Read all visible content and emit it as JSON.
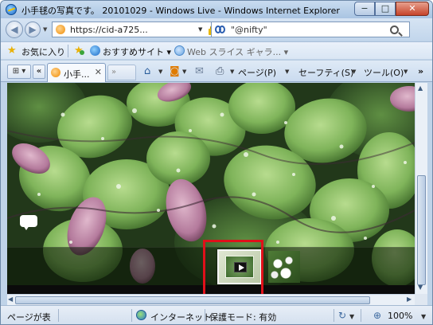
{
  "window": {
    "title": "小手毬の写真です。 20101029 - Windows Live - Windows Internet Explorer",
    "controls": {
      "minimize": "−",
      "maximize": "□",
      "close": "✕"
    }
  },
  "address_bar": {
    "url": "https://cid-a725...",
    "search_text": "\"@nifty\""
  },
  "favorites_bar": {
    "favorites_label": "お気に入り",
    "suggested_sites": "おすすめサイト ▾",
    "web_slice": "Web スライス ギャラ... ▾"
  },
  "tabs": {
    "quick_tabs_icon": "⊞ ▾",
    "tab_list_icon": "«",
    "active_tab_label": "小手...",
    "close_icon": "✕",
    "new_tab_icon": "»"
  },
  "command_bar": {
    "page_menu": "ページ(P)",
    "safety_menu": "セーフティ(S)",
    "tools_menu": "ツール(O)",
    "help_icon": "»"
  },
  "status_bar": {
    "status_text": "ページが表",
    "zone_text": "インターネット",
    "protected_mode": "保護モード: 有効",
    "zoom": "100%"
  },
  "colors": {
    "highlight": "#e0101a",
    "leaf_green": "#7fb45a",
    "leaf_purple": "#b47a9c"
  }
}
